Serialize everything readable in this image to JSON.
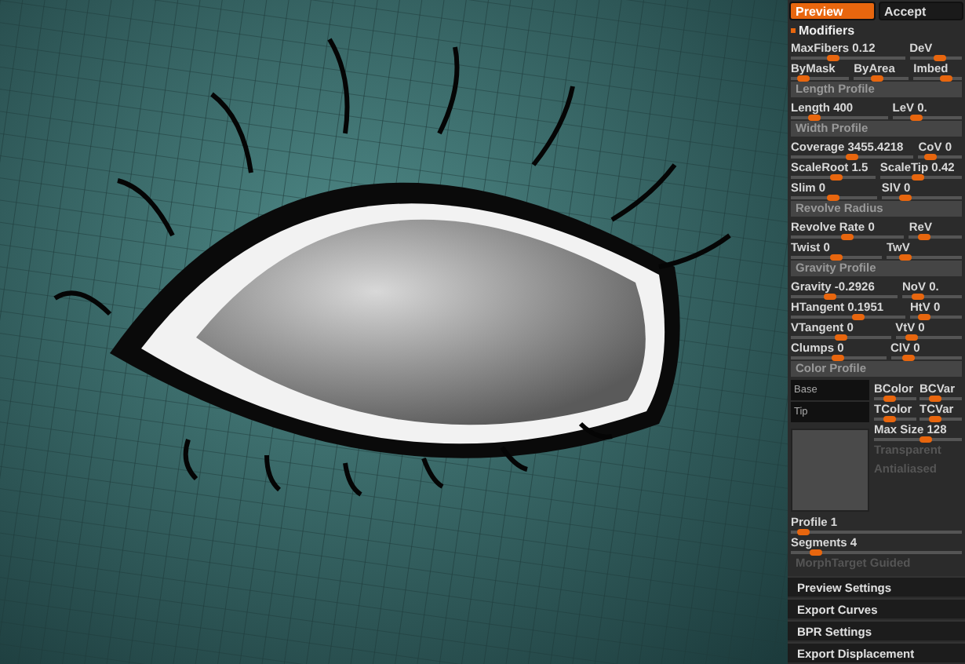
{
  "tabs": [
    {
      "label": "Preview",
      "selected": true
    },
    {
      "label": "Accept",
      "selected": false
    }
  ],
  "rows": [
    {
      "kind": "header",
      "label": "Modifiers"
    },
    {
      "kind": "sliders",
      "sliders": [
        {
          "label": "MaxFibers",
          "value": "0.12",
          "level": 0.35
        },
        {
          "label": "DeV",
          "level": 0.6
        }
      ]
    },
    {
      "kind": "sliders",
      "sliders": [
        {
          "label": "ByMask",
          "level": 0.15
        },
        {
          "label": "ByArea",
          "level": 0.4
        },
        {
          "label": "Imbed",
          "level": 0.75
        }
      ]
    },
    {
      "kind": "section",
      "label": "Length Profile"
    },
    {
      "kind": "sliders",
      "sliders": [
        {
          "label": "Length",
          "value": "400",
          "level": 0.2
        },
        {
          "label": "LeV",
          "value": "0.",
          "level": 0.3
        }
      ]
    },
    {
      "kind": "section",
      "label": "Width Profile"
    },
    {
      "kind": "sliders",
      "sliders": [
        {
          "label": "Coverage",
          "value": "3455.4218",
          "level": 0.5
        },
        {
          "label": "CoV",
          "value": "0",
          "level": 0.2
        }
      ]
    },
    {
      "kind": "sliders",
      "sliders": [
        {
          "label": "ScaleRoot",
          "value": "1.5",
          "level": 0.55
        },
        {
          "label": "ScaleTip",
          "value": "0.42",
          "level": 0.45
        }
      ]
    },
    {
      "kind": "sliders",
      "sliders": [
        {
          "label": "Slim",
          "value": "0",
          "level": 0.5
        },
        {
          "label": "SlV",
          "value": "0",
          "level": 0.25
        }
      ]
    },
    {
      "kind": "section",
      "label": "Revolve Radius"
    },
    {
      "kind": "sliders",
      "sliders": [
        {
          "label": "Revolve Rate",
          "value": "0",
          "level": 0.5
        },
        {
          "label": "ReV",
          "level": 0.2
        }
      ]
    },
    {
      "kind": "sliders",
      "sliders": [
        {
          "label": "Twist",
          "value": "0",
          "level": 0.5
        },
        {
          "label": "TwV",
          "level": 0.2
        }
      ]
    },
    {
      "kind": "section",
      "label": "Gravity Profile"
    },
    {
      "kind": "sliders",
      "sliders": [
        {
          "label": "Gravity",
          "value": "-0.2926",
          "level": 0.35
        },
        {
          "label": "NoV",
          "value": "0.",
          "level": 0.2
        }
      ]
    },
    {
      "kind": "sliders",
      "sliders": [
        {
          "label": "HTangent",
          "value": "0.1951",
          "level": 0.6
        },
        {
          "label": "HtV",
          "value": "0",
          "level": 0.2
        }
      ]
    },
    {
      "kind": "sliders",
      "sliders": [
        {
          "label": "VTangent",
          "value": "0",
          "level": 0.5
        },
        {
          "label": "VtV",
          "value": "0",
          "level": 0.2
        }
      ]
    },
    {
      "kind": "sliders",
      "sliders": [
        {
          "label": "Clumps",
          "value": "0",
          "level": 0.5
        },
        {
          "label": "ClV",
          "value": "0",
          "level": 0.2
        }
      ]
    },
    {
      "kind": "section",
      "label": "Color Profile"
    },
    {
      "kind": "color_profile",
      "swatches": [
        {
          "label": "Base"
        },
        {
          "label": "Tip"
        }
      ],
      "sliders": [
        {
          "label": "BColor",
          "level": 0.3
        },
        {
          "label": "BCVar",
          "level": 0.3
        },
        {
          "label": "TColor",
          "level": 0.3
        },
        {
          "label": "TCVar",
          "level": 0.3
        },
        {
          "label": "Max Size",
          "value": "128",
          "level": 0.6
        }
      ],
      "toggles": [
        {
          "label": "Transparent",
          "disabled": true
        },
        {
          "label": "Antialiased",
          "disabled": true
        }
      ]
    },
    {
      "kind": "sliders",
      "sliders": [
        {
          "label": "Profile",
          "value": "1",
          "level": 0.04
        }
      ]
    },
    {
      "kind": "sliders",
      "sliders": [
        {
          "label": "Segments",
          "value": "4",
          "level": 0.12
        }
      ]
    },
    {
      "kind": "toggle",
      "label": "MorphTarget Guided",
      "disabled": true
    }
  ],
  "menu": [
    "Preview Settings",
    "Export Curves",
    "BPR Settings",
    "Export Displacement"
  ]
}
